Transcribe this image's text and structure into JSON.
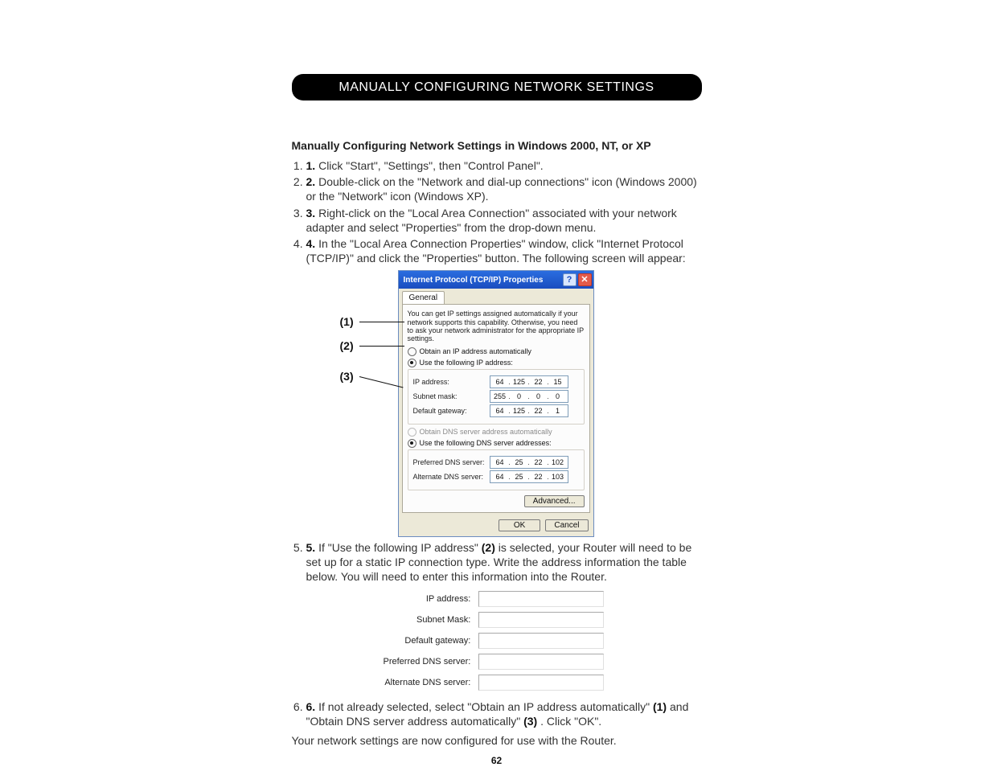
{
  "banner": "MANUALLY CONFIGURING NETWORK SETTINGS",
  "section_title": "Manually Configuring Network Settings in Windows 2000, NT, or XP",
  "steps": {
    "s1": "Click \"Start\", \"Settings\", then \"Control Panel\".",
    "s2": "Double-click on the \"Network and dial-up connections\" icon (Windows 2000) or the \"Network\" icon (Windows XP).",
    "s3": "Right-click on the \"Local Area Connection\" associated with your network adapter and select \"Properties\" from the drop-down menu.",
    "s4": "In the \"Local Area Connection Properties\" window, click \"Internet Protocol (TCP/IP)\" and click the \"Properties\" button. The following screen will appear:",
    "s5a": "If \"Use the following IP address\" ",
    "s5b": " is selected, your Router will need to be set up for a static IP connection type. Write the address information the table below. You will need to enter this information into the Router.",
    "s6a": "If not already selected, select \"Obtain an IP address automatically\" ",
    "s6b": " and \"Obtain DNS server address automatically\" ",
    "s6c": ". Click \"OK\"."
  },
  "callouts": {
    "c1": "(1)",
    "c2": "(2)",
    "c3": "(3)"
  },
  "dialog": {
    "title": "Internet Protocol (TCP/IP) Properties",
    "help_glyph": "?",
    "close_glyph": "✕",
    "tab": "General",
    "desc": "You can get IP settings assigned automatically if your network supports this capability. Otherwise, you need to ask your network administrator for the appropriate IP settings.",
    "radio_auto_ip": "Obtain an IP address automatically",
    "radio_use_ip": "Use the following IP address:",
    "labels": {
      "ip": "IP address:",
      "mask": "Subnet mask:",
      "gw": "Default gateway:",
      "pdns": "Preferred DNS server:",
      "adns": "Alternate DNS server:"
    },
    "ip": {
      "a": "64",
      "b": "125",
      "c": "22",
      "d": "15"
    },
    "mask": {
      "a": "255",
      "b": "0",
      "c": "0",
      "d": "0"
    },
    "gw": {
      "a": "64",
      "b": "125",
      "c": "22",
      "d": "1"
    },
    "radio_auto_dns": "Obtain DNS server address automatically",
    "radio_use_dns": "Use the following DNS server addresses:",
    "pdns": {
      "a": "64",
      "b": "25",
      "c": "22",
      "d": "102"
    },
    "adns": {
      "a": "64",
      "b": "25",
      "c": "22",
      "d": "103"
    },
    "advanced": "Advanced...",
    "ok": "OK",
    "cancel": "Cancel"
  },
  "form": {
    "ip": "IP address:",
    "mask": "Subnet Mask:",
    "gw": "Default gateway:",
    "pdns": "Preferred DNS server:",
    "adns": "Alternate DNS server:"
  },
  "final": "Your network settings are now configured for use with the Router.",
  "page_number": "62"
}
